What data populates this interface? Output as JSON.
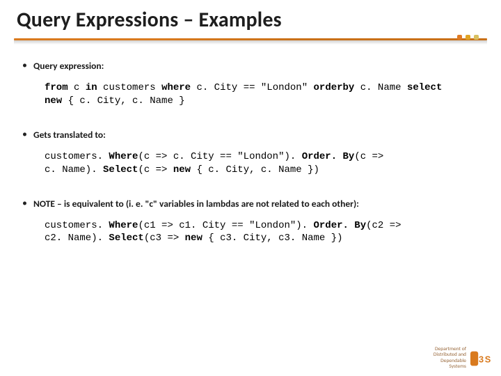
{
  "title": "Query Expressions – Examples",
  "bullets": [
    {
      "label": "Query expression:",
      "code_html": "<span class='kw'>from</span> c <span class='kw'>in</span> customers <span class='kw'>where</span> c. City == \"London\" <span class='kw'>orderby</span> c. Name <span class='kw'>select</span>\n<span class='kw'>new</span> { c. City, c. Name }"
    },
    {
      "label": "Gets translated to:",
      "code_html": "customers. <span class='kw'>Where</span>(c => c. City == \"London\"). <span class='kw'>Order. By</span>(c =>\nc. Name). <span class='kw'>Select</span>(c => <span class='kw'>new</span> { c. City, c. Name })"
    },
    {
      "label": "NOTE – is equivalent to (i. e. \"c\" variables in lambdas are not related to each other):",
      "code_html": "customers. <span class='kw'>Where</span>(c1 => c1. City == \"London\"). <span class='kw'>Order. By</span>(c2 =>\nc2. Name). <span class='kw'>Select</span>(c3 => <span class='kw'>new</span> { c3. City, c3. Name })"
    }
  ],
  "footer": {
    "line1": "Department of",
    "line2": "Distributed and",
    "line3": "Dependable",
    "line4": "Systems"
  }
}
